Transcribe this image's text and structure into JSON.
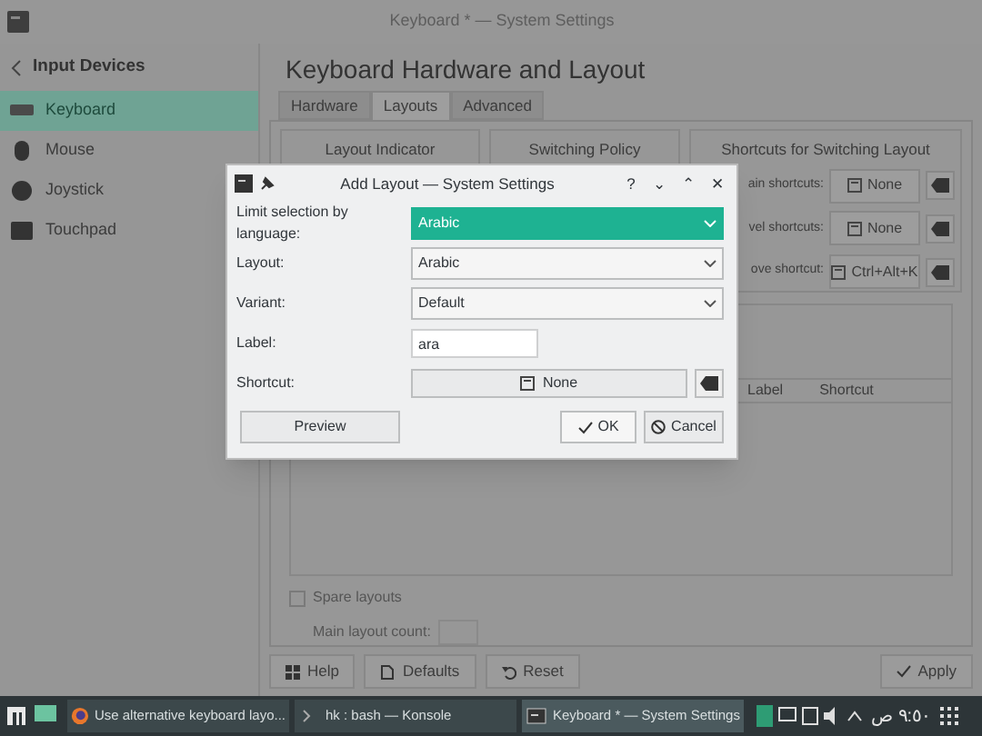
{
  "window": {
    "title": "Keyboard * — System Settings"
  },
  "sidebar": {
    "back_label": "Input Devices",
    "items": [
      {
        "label": "Keyboard",
        "selected": true
      },
      {
        "label": "Mouse",
        "selected": false
      },
      {
        "label": "Joystick",
        "selected": false
      },
      {
        "label": "Touchpad",
        "selected": false
      }
    ]
  },
  "page": {
    "title": "Keyboard Hardware and Layout",
    "tabs": [
      {
        "label": "Hardware",
        "selected": false
      },
      {
        "label": "Layouts",
        "selected": true
      },
      {
        "label": "Advanced",
        "selected": false
      }
    ],
    "groups": [
      {
        "title": "Layout Indicator"
      },
      {
        "title": "Switching Policy"
      },
      {
        "title": "Shortcuts for Switching Layout",
        "rows": [
          {
            "label": "ain shortcuts:",
            "value": "None"
          },
          {
            "label": "vel shortcuts:",
            "value": "None"
          },
          {
            "label": "ove shortcut:",
            "value": "Ctrl+Alt+K"
          }
        ]
      }
    ],
    "table": {
      "columns": [
        "Label",
        "Shortcut"
      ]
    },
    "spare_layouts": {
      "label": "Spare layouts",
      "checked": false
    },
    "main_layout_count": {
      "label": "Main layout count:"
    },
    "buttons": [
      {
        "label": "Help"
      },
      {
        "label": "Defaults"
      },
      {
        "label": "Reset"
      }
    ],
    "apply": "Apply"
  },
  "dialog": {
    "title": "Add Layout — System Settings",
    "controls": [
      "?",
      "⌄",
      "⌃",
      "✕"
    ],
    "fields": [
      {
        "kind": "combo",
        "label": "Limit selection by language:",
        "value": "Arabic",
        "focused": true
      },
      {
        "kind": "combo",
        "label": "Layout:",
        "value": "Arabic",
        "focused": false
      },
      {
        "kind": "combo",
        "label": "Variant:",
        "value": "Default",
        "focused": false
      },
      {
        "kind": "text",
        "label": "Label:",
        "value": "ara"
      },
      {
        "kind": "shortcut",
        "label": "Shortcut:",
        "value": "None"
      }
    ],
    "preview": "Preview",
    "ok": "OK",
    "cancel": "Cancel"
  },
  "taskbar": {
    "tasks": [
      {
        "label": "Use alternative keyboard layo...",
        "selected": false
      },
      {
        "label": "hk : bash — Konsole",
        "selected": false
      },
      {
        "label": "Keyboard * — System Settings",
        "selected": true
      }
    ],
    "clock": "٩:٥٠ ص"
  }
}
